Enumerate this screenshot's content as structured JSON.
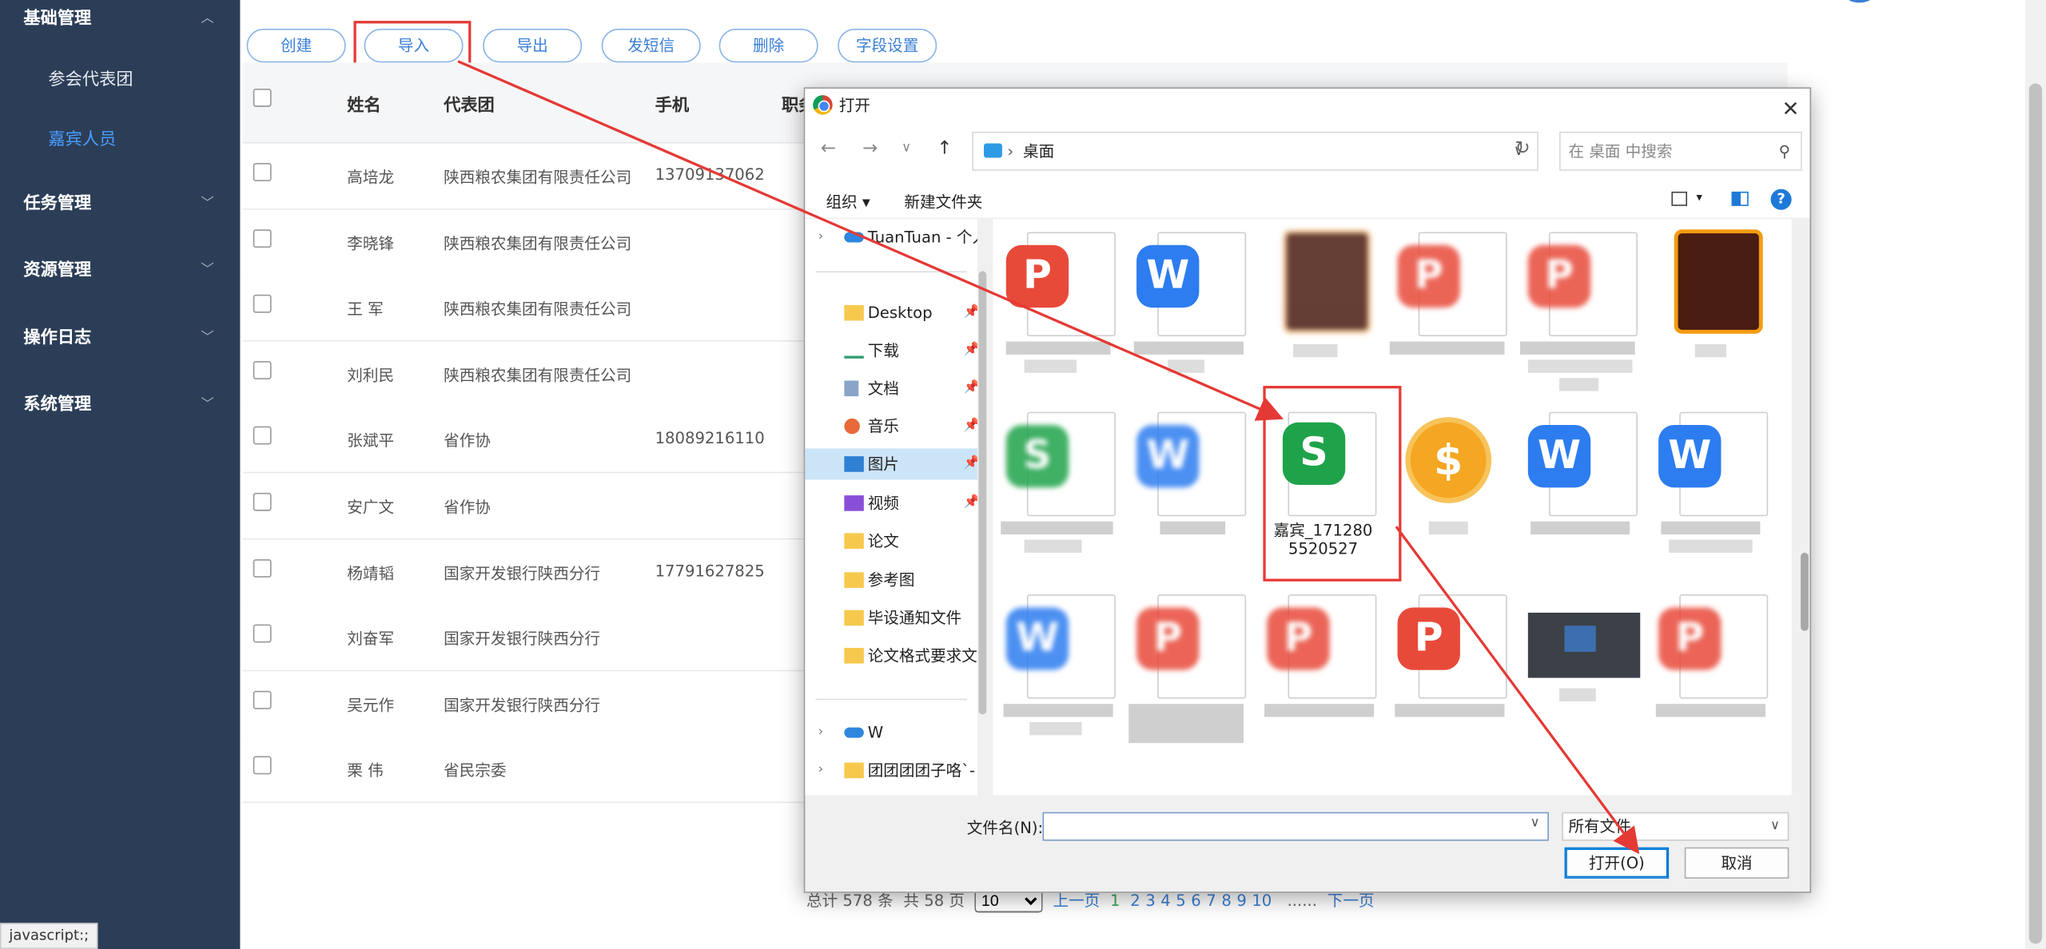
{
  "sidebar": {
    "groups": [
      {
        "label": "基础管理",
        "expanded": true
      },
      {
        "label": "任务管理"
      },
      {
        "label": "资源管理"
      },
      {
        "label": "操作日志"
      },
      {
        "label": "系统管理"
      }
    ],
    "subitems": [
      {
        "label": "参会代表团"
      },
      {
        "label": "嘉宾人员",
        "active": true
      }
    ],
    "status_text": "javascript:;"
  },
  "toolbar": {
    "create": "创建",
    "import": "导入",
    "export": "导出",
    "sms": "发短信",
    "delete": "删除",
    "fields": "字段设置"
  },
  "table": {
    "headers": {
      "name": "姓名",
      "delegation": "代表团",
      "phone": "手机",
      "position": "职务"
    },
    "rows": [
      {
        "name": "高培龙",
        "delegation": "陕西粮农集团有限责任公司",
        "phone": "13709137062"
      },
      {
        "name": "李晓锋",
        "delegation": "陕西粮农集团有限责任公司",
        "phone": ""
      },
      {
        "name": "王 军",
        "delegation": "陕西粮农集团有限责任公司",
        "phone": ""
      },
      {
        "name": "刘利民",
        "delegation": "陕西粮农集团有限责任公司",
        "phone": ""
      },
      {
        "name": "张斌平",
        "delegation": "省作协",
        "phone": "18089216110"
      },
      {
        "name": "安广文",
        "delegation": "省作协",
        "phone": ""
      },
      {
        "name": "杨靖韬",
        "delegation": "国家开发银行陕西分行",
        "phone": "17791627825"
      },
      {
        "name": "刘奋军",
        "delegation": "国家开发银行陕西分行",
        "phone": ""
      },
      {
        "name": "吴元作",
        "delegation": "国家开发银行陕西分行",
        "phone": ""
      },
      {
        "name": "栗 伟",
        "delegation": "省民宗委",
        "phone": ""
      }
    ]
  },
  "pager": {
    "total": "总计 578 条",
    "pages": "共 58 页",
    "page_size": "10",
    "prev": "上一页",
    "current": "1",
    "numbers": [
      "2",
      "3",
      "4",
      "5",
      "6",
      "7",
      "8",
      "9",
      "10"
    ],
    "ellipsis": "......",
    "next": "下一页"
  },
  "dialog": {
    "title": "打开",
    "path_segment": "桌面",
    "search_placeholder": "在 桌面 中搜索",
    "organize": "组织",
    "new_folder": "新建文件夹",
    "help": "?",
    "nav_items": [
      {
        "label": "TuanTuan - 个人",
        "icon": "onedrive-icon"
      },
      {
        "label": "Desktop",
        "icon": "folder-icon",
        "pinned": true
      },
      {
        "label": "下载",
        "icon": "download-icon",
        "pinned": true
      },
      {
        "label": "文档",
        "icon": "document-icon",
        "pinned": true
      },
      {
        "label": "音乐",
        "icon": "music-icon",
        "pinned": true
      },
      {
        "label": "图片",
        "icon": "picture-icon",
        "pinned": true,
        "selected": true
      },
      {
        "label": "视频",
        "icon": "video-icon",
        "pinned": true
      },
      {
        "label": "论文",
        "icon": "folder-icon"
      },
      {
        "label": "参考图",
        "icon": "folder-icon"
      },
      {
        "label": "毕设通知文件",
        "icon": "folder-icon"
      },
      {
        "label": "论文格式要求文",
        "icon": "folder-icon"
      },
      {
        "label": "W",
        "icon": "onedrive-icon"
      },
      {
        "label": "团团团团子咯`-",
        "icon": "folder-icon"
      }
    ],
    "highlighted_file": "嘉宾_1712805520527",
    "filename_label": "文件名(N):",
    "filename_value": "",
    "filetype": "所有文件",
    "open_button": "打开(O)",
    "cancel_button": "取消",
    "colors": {
      "wps_pdf": "#e84a3a",
      "wps_writer": "#2d7df0",
      "wps_sheet": "#1fa34a",
      "highlight_box": "#e53935"
    }
  }
}
